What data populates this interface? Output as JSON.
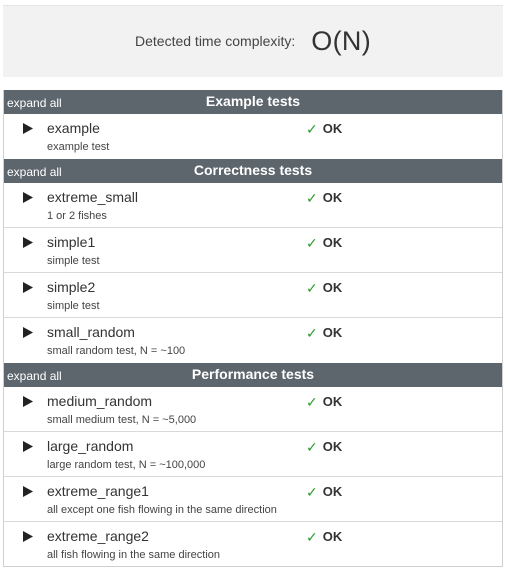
{
  "complexity": {
    "label": "Detected time complexity:",
    "value": "O(N)"
  },
  "colors": {
    "header_bg": "#5d666d",
    "ok_check": "#2a9a2a",
    "complexity_bg": "#f2f2f2"
  },
  "groups": [
    {
      "expand_label": "expand all",
      "title": "Example tests",
      "tests": [
        {
          "name": "example",
          "description": "example test",
          "status": "OK",
          "status_icon": "check-icon"
        }
      ]
    },
    {
      "expand_label": "expand all",
      "title": "Correctness tests",
      "tests": [
        {
          "name": "extreme_small",
          "description": "1 or 2 fishes",
          "status": "OK",
          "status_icon": "check-icon"
        },
        {
          "name": "simple1",
          "description": "simple test",
          "status": "OK",
          "status_icon": "check-icon"
        },
        {
          "name": "simple2",
          "description": "simple test",
          "status": "OK",
          "status_icon": "check-icon"
        },
        {
          "name": "small_random",
          "description": "small random test, N = ~100",
          "status": "OK",
          "status_icon": "check-icon"
        }
      ]
    },
    {
      "expand_label": "expand all",
      "title": "Performance tests",
      "tests": [
        {
          "name": "medium_random",
          "description": "small medium test, N = ~5,000",
          "status": "OK",
          "status_icon": "check-icon"
        },
        {
          "name": "large_random",
          "description": "large random test, N = ~100,000",
          "status": "OK",
          "status_icon": "check-icon"
        },
        {
          "name": "extreme_range1",
          "description": "all except one fish flowing in the same direction",
          "status": "OK",
          "status_icon": "check-icon"
        },
        {
          "name": "extreme_range2",
          "description": "all fish flowing in the same direction",
          "status": "OK",
          "status_icon": "check-icon"
        }
      ]
    }
  ]
}
